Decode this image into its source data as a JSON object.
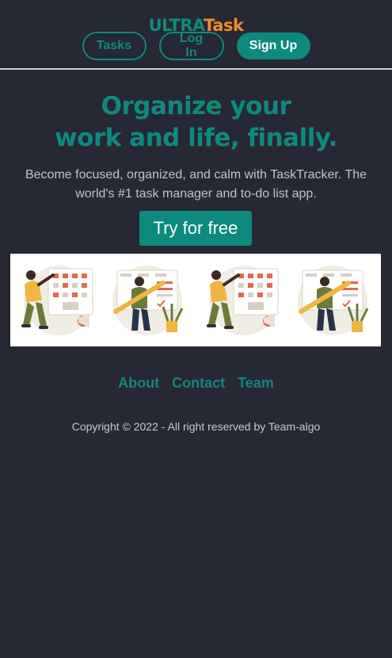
{
  "header": {
    "logo_part1": "ULTRA",
    "logo_part2": "Task",
    "nav": {
      "tasks_label": "Tasks",
      "login_label": "Log In",
      "signup_label": "Sign Up"
    }
  },
  "hero": {
    "title_line1": "Organize your",
    "title_line2": "work and life, finally.",
    "subtitle": "Become focused, organized, and calm with TaskTracker. The world's #1 task manager and to-do list app.",
    "cta_label": "Try for free"
  },
  "banner": {
    "illustrations": [
      "woman-checklist-illustration",
      "man-pencil-illustration",
      "woman-checklist-illustration",
      "man-pencil-illustration"
    ]
  },
  "footer": {
    "links": [
      "About",
      "Contact",
      "Team"
    ],
    "copyright": "Copyright © 2022 - All right reserved by Team-algo"
  },
  "colors": {
    "background": "#262833",
    "accent": "#0e8a7c",
    "logo_orange": "#f08a2a"
  }
}
